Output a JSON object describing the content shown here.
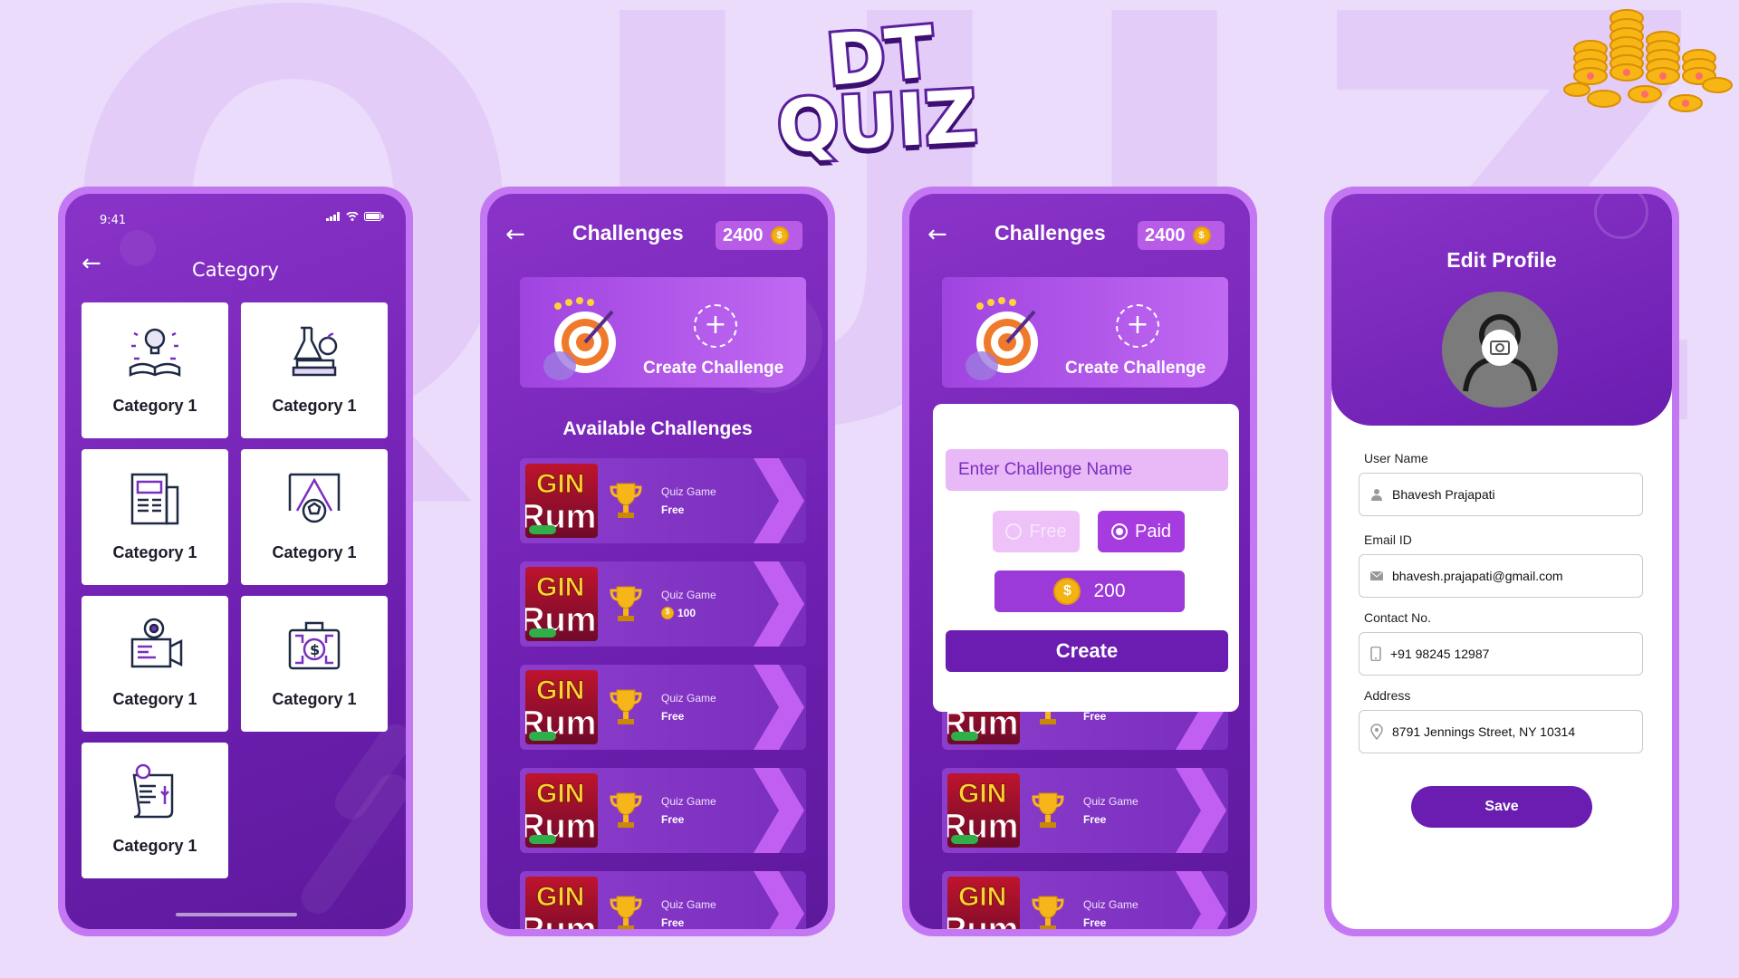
{
  "brand": {
    "background_word": "QUIZ",
    "logo_line1": "DT",
    "logo_line2": "QUIZ"
  },
  "colors": {
    "primary": "#6a1db0",
    "accent": "#c477f2",
    "coin": "#f4b315",
    "background": "#ecdcfb"
  },
  "category_screen": {
    "status_time": "9:41",
    "title": "Category",
    "categories": [
      {
        "label": "Category 1",
        "icon": "reading-lightbulb-icon"
      },
      {
        "label": "Category 1",
        "icon": "science-books-icon"
      },
      {
        "label": "Category 1",
        "icon": "newspaper-icon"
      },
      {
        "label": "Category 1",
        "icon": "sports-goal-icon"
      },
      {
        "label": "Category 1",
        "icon": "movie-camera-icon"
      },
      {
        "label": "Category 1",
        "icon": "money-case-icon"
      },
      {
        "label": "Category 1",
        "icon": "world-document-icon"
      }
    ]
  },
  "challenges_screen": {
    "title": "Challenges",
    "coins": "2400",
    "coin_symbol": "$",
    "create_label": "Create Challenge",
    "available_title": "Available Challenges",
    "rows": [
      {
        "type": "Quiz Game",
        "price": "Free",
        "paid": false
      },
      {
        "type": "Quiz Game",
        "price": "100",
        "paid": true
      },
      {
        "type": "Quiz Game",
        "price": "Free",
        "paid": false
      },
      {
        "type": "Quiz Game",
        "price": "Free",
        "paid": false
      },
      {
        "type": "Quiz Game",
        "price": "Free",
        "paid": false
      }
    ],
    "thumb_text_top": "GIN",
    "thumb_text_bottom": "Rumr"
  },
  "create_challenge_dialog": {
    "title": "Challenges",
    "coins": "2400",
    "create_label": "Create Challenge",
    "name_placeholder": "Enter Challenge Name",
    "option_free": "Free",
    "option_paid": "Paid",
    "selected_option": "Paid",
    "amount": "200",
    "coin_symbol": "$",
    "create_button": "Create",
    "rows": [
      {
        "type": "Quiz Game",
        "price": "Free"
      },
      {
        "type": "Quiz Game",
        "price": "Free"
      },
      {
        "type": "Quiz Game",
        "price": "Free"
      }
    ]
  },
  "edit_profile": {
    "title": "Edit Profile",
    "fields": [
      {
        "label": "User Name",
        "value": "Bhavesh Prajapati",
        "icon": "user-icon"
      },
      {
        "label": "Email ID",
        "value": "bhavesh.prajapati@gmail.com",
        "icon": "mail-icon"
      },
      {
        "label": "Contact No.",
        "value": "+91 98245 12987",
        "icon": "phone-icon"
      },
      {
        "label": "Address",
        "value": "8791 Jennings Street, NY 10314",
        "icon": "location-pin-icon"
      }
    ],
    "save_button": "Save"
  }
}
